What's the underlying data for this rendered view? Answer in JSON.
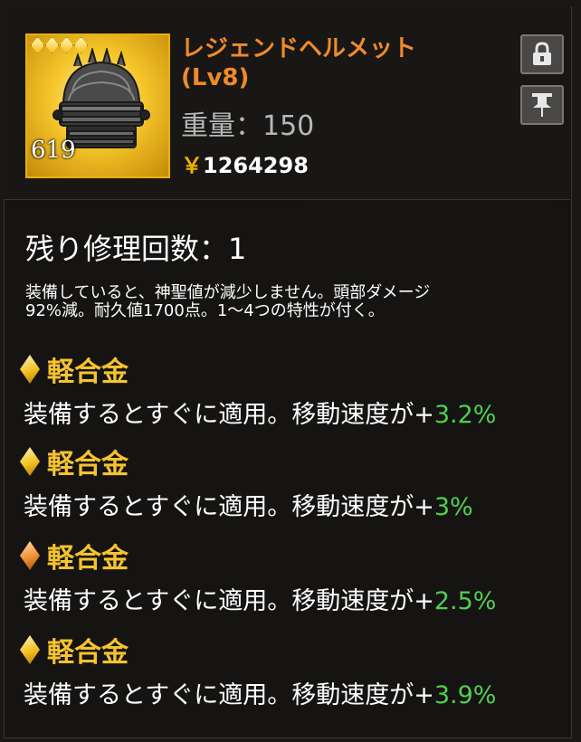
{
  "item": {
    "name": "レジェンドヘルメット",
    "level": "(Lv8)",
    "stack_count": "619",
    "rarity_stars": 4,
    "weight_label": "重量：150",
    "price_symbol": "￥",
    "price_value": "1264298"
  },
  "buttons": {
    "lock_icon": "lock-icon",
    "pin_icon": "pin-icon"
  },
  "repair_label": "残り修理回数：1",
  "description": {
    "line1": "装備していると、神聖値が減少しません。頭部ダメージ",
    "line2": "92%減。耐久値1700点。1～4つの特性が付く。"
  },
  "traits": [
    {
      "name": "軽合金",
      "effect": "装備するとすぐに適用。移動速度が",
      "sign": "+",
      "value": "3.2%",
      "gem_color": "#f2c020"
    },
    {
      "name": "軽合金",
      "effect": "装備するとすぐに適用。移動速度が",
      "sign": "+",
      "value": "3%",
      "gem_color": "#f2c020"
    },
    {
      "name": "軽合金",
      "effect": "装備するとすぐに適用。移動速度が",
      "sign": "+",
      "value": "2.5%",
      "gem_color": "#f09030"
    },
    {
      "name": "軽合金",
      "effect": "装備するとすぐに適用。移動速度が",
      "sign": "+",
      "value": "3.9%",
      "gem_color": "#f2c020"
    }
  ],
  "colors": {
    "title": "#f08a2a",
    "trait_name": "#f5c330",
    "trait_value": "#4fd04f"
  }
}
